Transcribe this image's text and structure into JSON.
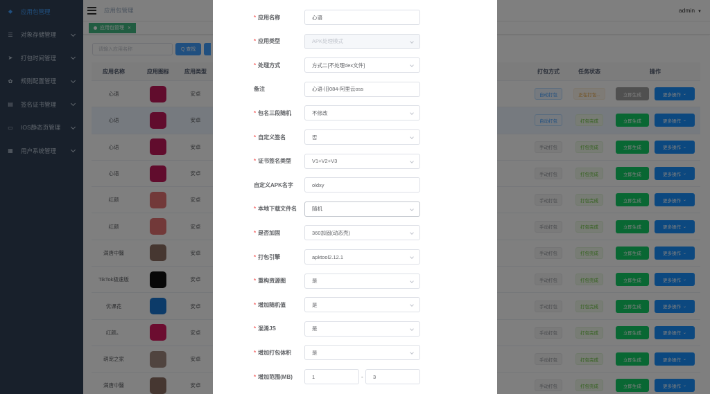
{
  "sidebar": {
    "items": [
      {
        "label": "应用包管理",
        "icon": "dashboard-icon",
        "glyph": "◆",
        "active": true
      },
      {
        "label": "对象存储管理",
        "icon": "list-icon",
        "glyph": "☰"
      },
      {
        "label": "打包时间管理",
        "icon": "send-icon",
        "glyph": "➤"
      },
      {
        "label": "规则配置管理",
        "icon": "gear-icon",
        "glyph": "✿"
      },
      {
        "label": "签名证书管理",
        "icon": "certificate-icon",
        "glyph": "▤"
      },
      {
        "label": "IOS静态页管理",
        "icon": "monitor-icon",
        "glyph": "▭"
      },
      {
        "label": "用户系统管理",
        "icon": "grid-icon",
        "glyph": "▦"
      }
    ]
  },
  "navbar": {
    "breadcrumb": "应用包管理",
    "user": "admin"
  },
  "tags": {
    "active": "应用包管理"
  },
  "search": {
    "placeholder": "请输入应用名称",
    "button": "Q 查找"
  },
  "table": {
    "headers": {
      "name": "应用名称",
      "icon": "应用图标",
      "type": "应用类型",
      "pack": "打包方式",
      "status": "任务状态",
      "ops": "操作"
    },
    "rows": [
      {
        "name": "心语",
        "type": "安卓",
        "pack": "自动打包",
        "status": "正在打包...",
        "gen": "立即生成",
        "more": "更多操作",
        "icon_color": "#c2185b"
      },
      {
        "name": "心语",
        "type": "安卓",
        "pack": "自动打包",
        "status": "打包完成",
        "gen": "立即生成",
        "more": "更多操作",
        "icon_color": "#c2185b"
      },
      {
        "name": "心语",
        "type": "安卓",
        "pack": "手动打包",
        "status": "打包完成",
        "gen": "立即生成",
        "more": "更多操作",
        "icon_color": "#c2185b"
      },
      {
        "name": "心语",
        "type": "安卓",
        "pack": "手动打包",
        "status": "打包完成",
        "gen": "立即生成",
        "more": "更多操作",
        "icon_color": "#c2185b"
      },
      {
        "name": "红颜",
        "type": "安卓",
        "pack": "手动打包",
        "status": "打包完成",
        "gen": "立即生成",
        "more": "更多操作",
        "icon_color": "#e57373"
      },
      {
        "name": "红颜",
        "type": "安卓",
        "pack": "手动打包",
        "status": "打包完成",
        "gen": "立即生成",
        "more": "更多操作",
        "icon_color": "#e57373"
      },
      {
        "name": "满唐中醫",
        "type": "安卓",
        "pack": "手动打包",
        "status": "打包完成",
        "gen": "立即生成",
        "more": "更多操作",
        "icon_color": "#8d6e63"
      },
      {
        "name": "TikTok极速版",
        "type": "安卓",
        "pack": "手动打包",
        "status": "打包完成",
        "gen": "立即生成",
        "more": "更多操作",
        "icon_color": "#111111"
      },
      {
        "name": "优课花",
        "type": "安卓",
        "pack": "手动打包",
        "status": "打包完成",
        "gen": "立即生成",
        "more": "更多操作",
        "icon_color": "#1976d2"
      },
      {
        "name": "红颜。",
        "type": "安卓",
        "pack": "手动打包",
        "status": "打包完成",
        "gen": "立即生成",
        "more": "更多操作",
        "icon_color": "#d81b60"
      },
      {
        "name": "萌宠之家",
        "type": "安卓",
        "pack": "手动打包",
        "status": "打包完成",
        "gen": "立即生成",
        "more": "更多操作",
        "icon_color": "#a1887f"
      },
      {
        "name": "满唐中醫",
        "type": "安卓",
        "pack": "手动打包",
        "status": "打包完成",
        "gen": "立即生成",
        "more": "更多操作",
        "icon_color": "#8d6e63"
      }
    ]
  },
  "form": {
    "fields": [
      {
        "label": "应用名称",
        "required": true,
        "value": "心语",
        "kind": "input"
      },
      {
        "label": "应用类型",
        "required": true,
        "value": "APK处理模式",
        "kind": "select",
        "disabled": true
      },
      {
        "label": "处理方式",
        "required": true,
        "value": "方式二[不处理dex文件]",
        "kind": "select"
      },
      {
        "label": "备注",
        "required": false,
        "value": "心语-旧084-阿里云oss",
        "kind": "input"
      },
      {
        "label": "包名三段随机",
        "required": true,
        "value": "不修改",
        "kind": "select"
      },
      {
        "label": "自定义签名",
        "required": true,
        "value": "否",
        "kind": "select"
      },
      {
        "label": "证书签名类型",
        "required": true,
        "value": "V1+V2+V3",
        "kind": "select"
      },
      {
        "label": "自定义APK名字",
        "required": false,
        "value": "oldxy",
        "kind": "input"
      },
      {
        "label": "本地下载文件名",
        "required": true,
        "value": "随机",
        "kind": "select",
        "focused": true
      },
      {
        "label": "是否加固",
        "required": true,
        "value": "360加固(动态壳)",
        "kind": "select"
      },
      {
        "label": "打包引擎",
        "required": true,
        "value": "apktool2.12.1",
        "kind": "select"
      },
      {
        "label": "重构资源图",
        "required": true,
        "value": "是",
        "kind": "select"
      },
      {
        "label": "增加随机值",
        "required": true,
        "value": "是",
        "kind": "select"
      },
      {
        "label": "混淆JS",
        "required": true,
        "value": "是",
        "kind": "select"
      },
      {
        "label": "增加打包体积",
        "required": true,
        "value": "是",
        "kind": "select"
      }
    ],
    "range": {
      "label": "增加范围(MB)",
      "required": true,
      "min": "1",
      "separator": "-",
      "max": "3"
    }
  }
}
